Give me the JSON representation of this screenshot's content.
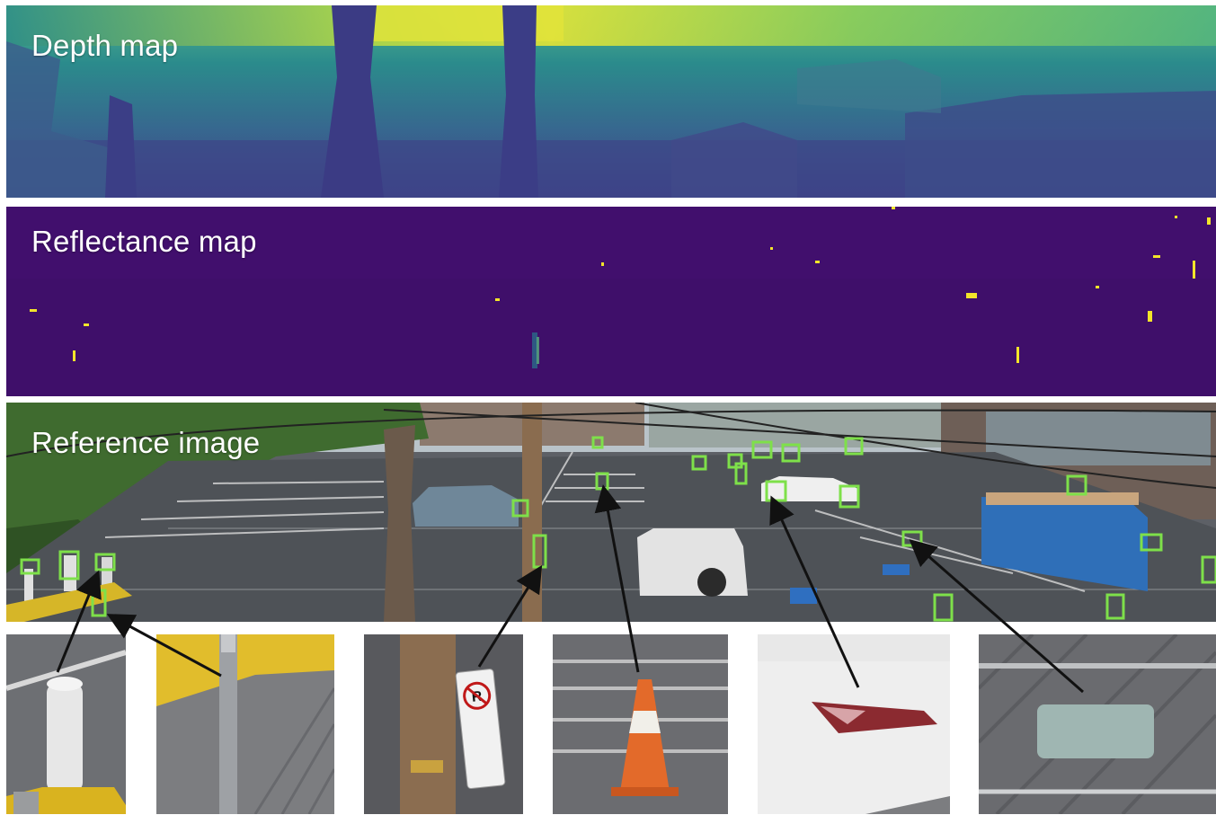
{
  "panels": {
    "depth": {
      "label": "Depth map"
    },
    "reflectance": {
      "label": "Reflectance map"
    },
    "reference": {
      "label": "Reference image"
    }
  },
  "colors": {
    "box": "#7ee04a",
    "arrow": "#111111",
    "depth_far": "#d2e23a",
    "depth_mid": "#2a8c8a",
    "depth_near": "#3b3f86",
    "reflectance_bg": "#3f0f6a",
    "reflectance_hot": "#f3e52a"
  },
  "crops": [
    {
      "name": "bollard-crop"
    },
    {
      "name": "curb-bollard-crop"
    },
    {
      "name": "no-parking-sign-crop"
    },
    {
      "name": "traffic-cone-crop"
    },
    {
      "name": "car-taillight-crop"
    },
    {
      "name": "fence-plate-crop"
    }
  ]
}
